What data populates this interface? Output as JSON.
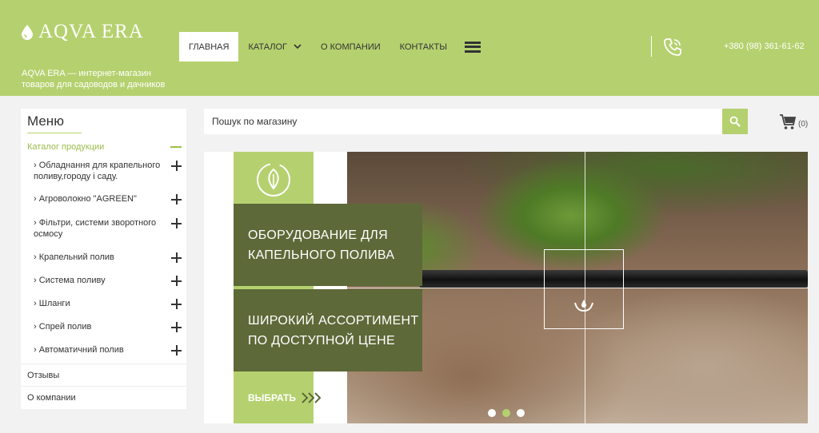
{
  "header": {
    "logo_text": "AQVA ERA",
    "tagline": "AQVA ERA — интернет-магазин товаров для садоводов и дачников",
    "nav": [
      {
        "label": "Главная",
        "active": true
      },
      {
        "label": "Каталог",
        "has_dropdown": true
      },
      {
        "label": "О компании"
      },
      {
        "label": "Контакты"
      }
    ],
    "phone": "+380 (98) 361-61-62"
  },
  "sidebar": {
    "title": "Меню",
    "catalog_label": "Каталог продукции",
    "items": [
      {
        "label": "Обладнання для крапельного поливу,городу і саду."
      },
      {
        "label": "Агроволокно \"AGREEN\""
      },
      {
        "label": "Фільтри, системи зворотного осмосу"
      },
      {
        "label": "Крапельний полив"
      },
      {
        "label": "Система поливу"
      },
      {
        "label": "Шланги"
      },
      {
        "label": "Спрей полив"
      },
      {
        "label": "Автоматичний полив"
      }
    ],
    "plain_items": [
      "Отзывы",
      "О компании"
    ]
  },
  "search": {
    "placeholder": "Пошук по магазину"
  },
  "cart": {
    "count": "(0)"
  },
  "slider": {
    "headline": "Оборудование для капельного полива",
    "subline": "Широкий ассортимент по доступной цене",
    "cta": "Выбрать",
    "slides": 3,
    "active_slide": 2
  },
  "colors": {
    "brand_green": "#b5d16f",
    "dark_olive": "#5d6938"
  }
}
